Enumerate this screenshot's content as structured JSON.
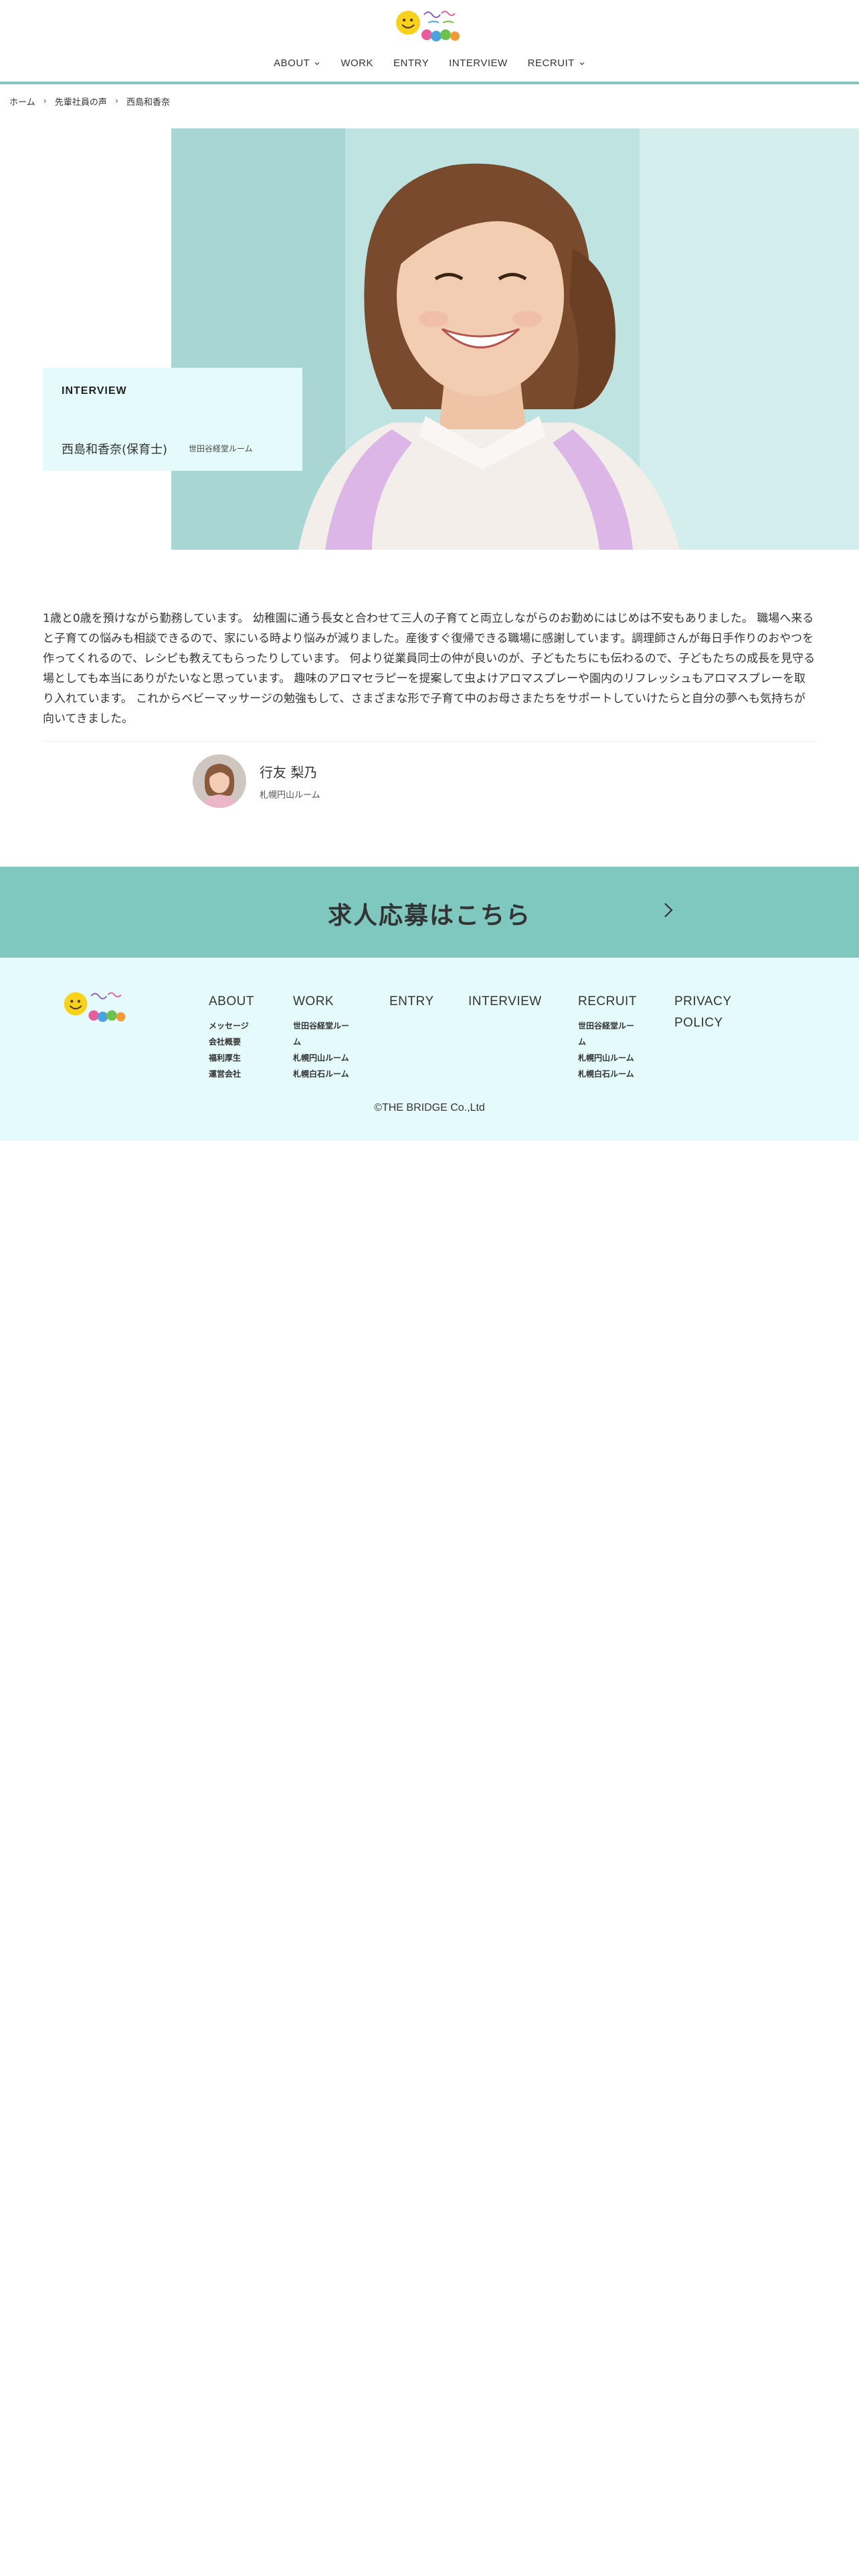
{
  "header": {
    "logo_alt": "ベビー&キッズ",
    "nav": [
      {
        "label": "ABOUT",
        "has_dropdown": true
      },
      {
        "label": "WORK",
        "has_dropdown": false
      },
      {
        "label": "ENTRY",
        "has_dropdown": false
      },
      {
        "label": "INTERVIEW",
        "has_dropdown": false
      },
      {
        "label": "RECRUIT",
        "has_dropdown": true
      }
    ]
  },
  "breadcrumb": {
    "home": "ホーム",
    "parent": "先輩社員の声",
    "current": "西島和香奈",
    "separator": "›"
  },
  "intro": {
    "tag": "INTERVIEW",
    "name": "西島和香奈(保育士)",
    "room": "世田谷経堂ルーム"
  },
  "body": {
    "text": "1歳と0歳を預けながら勤務しています。 幼稚園に通う長女と合わせて三人の子育てと両立しながらのお勤めにはじめは不安もありました。 職場へ来ると子育ての悩みも相談できるので、家にいる時より悩みが減りました。産後すぐ復帰できる職場に感謝しています。調理師さんが毎日手作りのおやつを作ってくれるので、レシピも教えてもらったりしています。 何より従業員同士の仲が良いのが、子どもたちにも伝わるので、子どもたちの成長を見守る場としても本当にありがたいなと思っています。 趣味のアロマセラピーを提案して虫よけアロマスプレーや園内のリフレッシュもアロマスプレーを取り入れています。 これからベビーマッサージの勉強もして、さまざまな形で子育て中のお母さまたちをサポートしていけたらと自分の夢へも気持ちが向いてきました。"
  },
  "other_staff": {
    "name": "行友 梨乃",
    "room": "札幌円山ルーム"
  },
  "cta": {
    "label": "求人応募はこちら"
  },
  "footer": {
    "columns": [
      {
        "title": "ABOUT",
        "links": [
          "メッセージ",
          "会社概要",
          "福利厚生",
          "運営会社"
        ]
      },
      {
        "title": "WORK",
        "links": [
          "世田谷経堂ルー\nム",
          "札幌円山ルーム",
          "札幌白石ルーム"
        ]
      },
      {
        "title": "ENTRY",
        "links": []
      },
      {
        "title": "INTERVIEW",
        "links": []
      },
      {
        "title": "RECRUIT",
        "links": [
          "世田谷経堂ルー\nム",
          "札幌円山ルーム",
          "札幌白石ルーム"
        ]
      },
      {
        "title": "PRIVACY\nPOLICY",
        "links": []
      }
    ],
    "copyright": "©THE BRIDGE Co.,Ltd"
  },
  "colors": {
    "accent": "#7fc8bf",
    "light_bg": "#e5fbfb",
    "text": "#333333"
  }
}
